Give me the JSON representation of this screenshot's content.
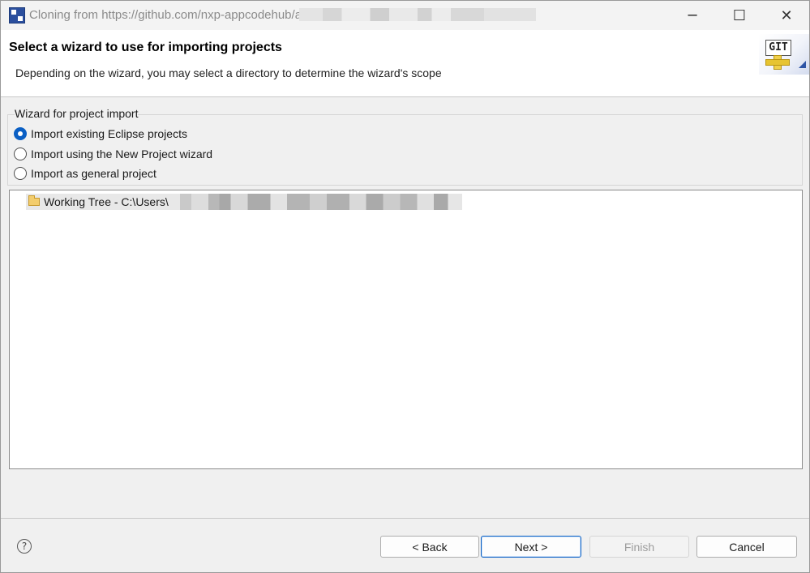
{
  "window": {
    "title": "Cloning from https://github.com/nxp-appcodehub/a",
    "minimize_glyph": "─",
    "maximize_glyph": "☐",
    "close_glyph": "✕"
  },
  "header": {
    "title": "Select a wizard to use for importing projects",
    "description": "Depending on the wizard, you may select a directory to determine the wizard's scope",
    "logo_text": "GIT"
  },
  "wizard_group": {
    "label": "Wizard for project import",
    "options": [
      {
        "label": "Import existing Eclipse projects",
        "selected": true
      },
      {
        "label": "Import using the New Project wizard",
        "selected": false
      },
      {
        "label": "Import as general project",
        "selected": false
      }
    ]
  },
  "tree": {
    "items": [
      {
        "label": "Working Tree - C:\\Users\\",
        "icon": "folder-open-icon"
      }
    ]
  },
  "footer": {
    "help_glyph": "?",
    "back_label": "< Back",
    "next_label": "Next >",
    "finish_label": "Finish",
    "cancel_label": "Cancel"
  },
  "colors": {
    "accent": "#0a5fc4",
    "selection": "#e8e8e8",
    "disabled_text": "#9d9d9d"
  }
}
